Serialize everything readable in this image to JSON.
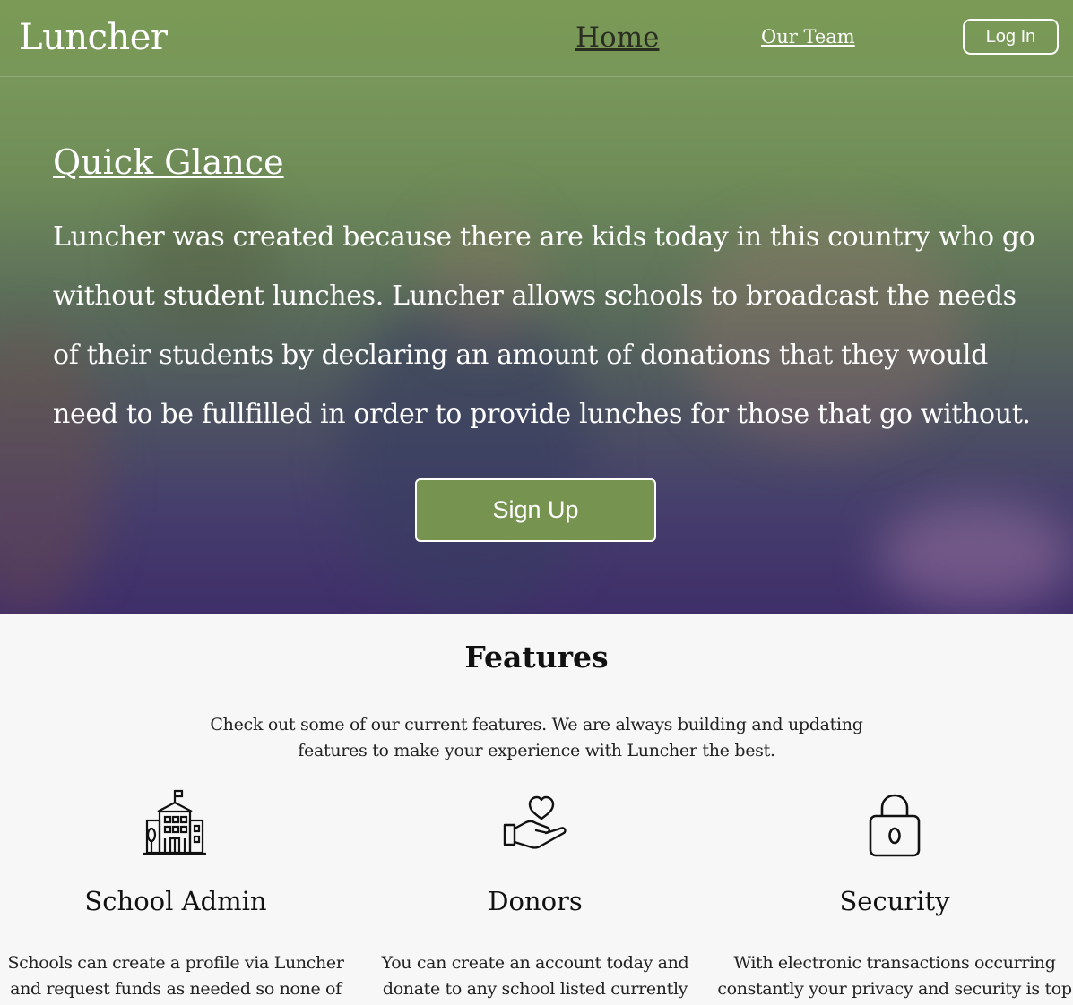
{
  "nav": {
    "brand": "Luncher",
    "home": "Home",
    "team": "Our Team",
    "login": "Log In"
  },
  "hero": {
    "title": "Quick Glance",
    "text": "Luncher was created because there are kids today in this country who go without student lunches. Luncher allows schools to broadcast the needs of their students by declaring an amount of donations that they would need to be fullfilled in order to provide lunches for those that go without.",
    "signup": "Sign Up"
  },
  "features": {
    "title": "Features",
    "intro": "Check out some of our current features. We are always building and updating features to make your experience with Luncher the best.",
    "items": [
      {
        "icon": "school-building-icon",
        "title": "School Admin",
        "text": "Schools can create a profile via Luncher and request funds as needed so none of"
      },
      {
        "icon": "hand-heart-icon",
        "title": "Donors",
        "text": "You can create an account today and donate to any school listed currently"
      },
      {
        "icon": "padlock-icon",
        "title": "Security",
        "text": "With electronic transactions occurring constantly your privacy and security is top"
      }
    ]
  },
  "colors": {
    "brand_green": "#76944f",
    "hero_top": "#7a9a55",
    "hero_bottom": "#3f2e6a",
    "page_bg": "#f7f7f7"
  }
}
